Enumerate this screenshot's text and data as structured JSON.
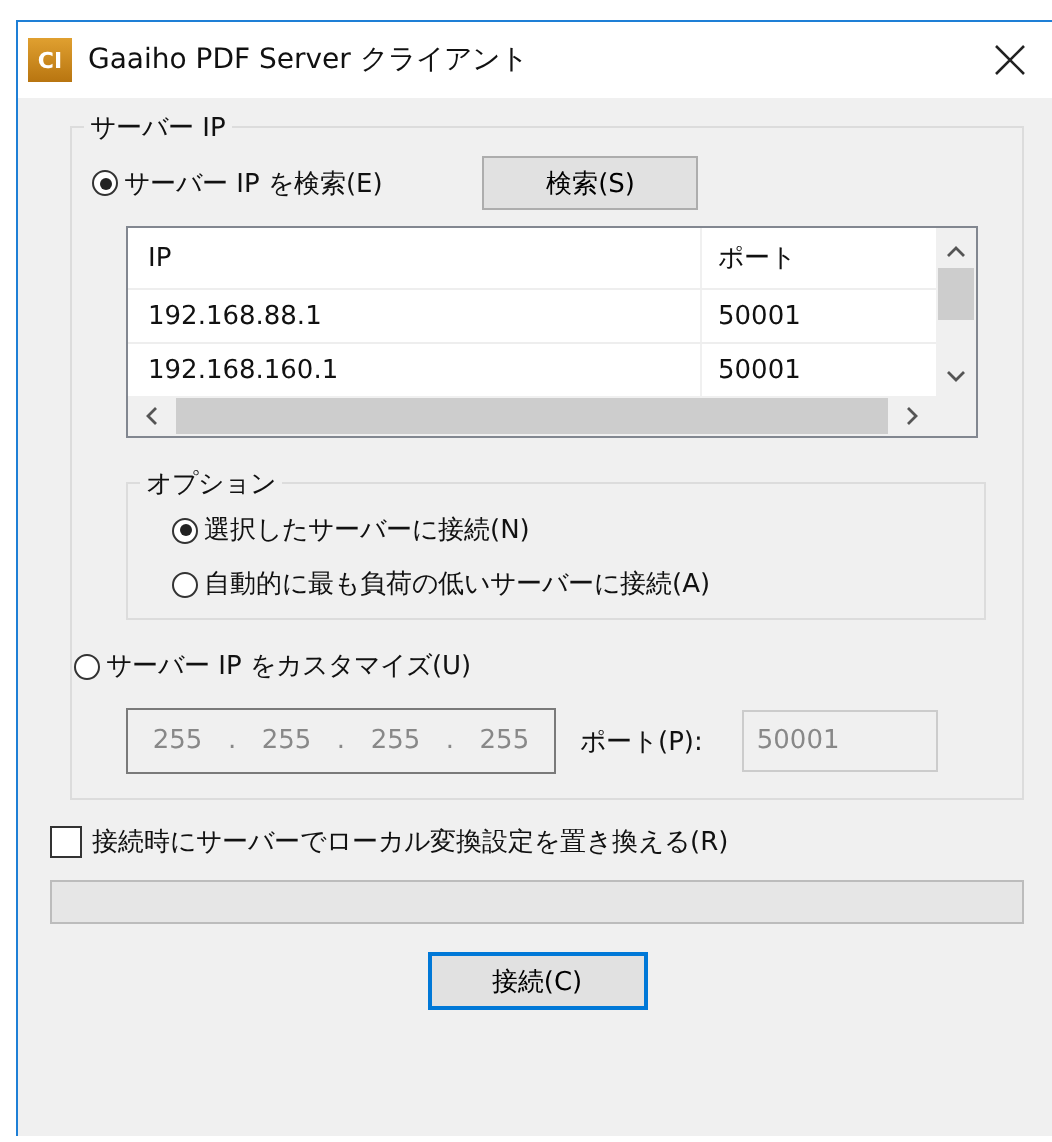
{
  "window": {
    "title": "Gaaiho PDF Server クライアント",
    "icon_text": "CI"
  },
  "server_group": {
    "label": "サーバー IP",
    "search_radio": {
      "label": "サーバー IP を検索(E)",
      "selected": true
    },
    "search_button": "検索(S)",
    "table": {
      "columns": [
        "IP",
        "ポート"
      ],
      "rows": [
        {
          "cells": [
            "192.168.88.1",
            "50001"
          ]
        },
        {
          "cells": [
            "192.168.160.1",
            "50001"
          ]
        }
      ]
    },
    "options": {
      "label": "オプション",
      "items": [
        {
          "label": "選択したサーバーに接続(N)",
          "selected": true
        },
        {
          "label": "自動的に最も負荷の低いサーバーに接続(A)",
          "selected": false
        }
      ]
    },
    "custom_radio": {
      "label": "サーバー IP をカスタマイズ(U)",
      "selected": false
    },
    "ip_octets": [
      "255",
      "255",
      "255",
      "255"
    ],
    "ip_separator": ".",
    "port_label": "ポート(P):",
    "port_value": "50001"
  },
  "replace_checkbox": {
    "label": "接続時にサーバーでローカル変換設定を置き換える(R)",
    "checked": false
  },
  "progress": {
    "level": 0
  },
  "connect_button": "接続(C)"
}
